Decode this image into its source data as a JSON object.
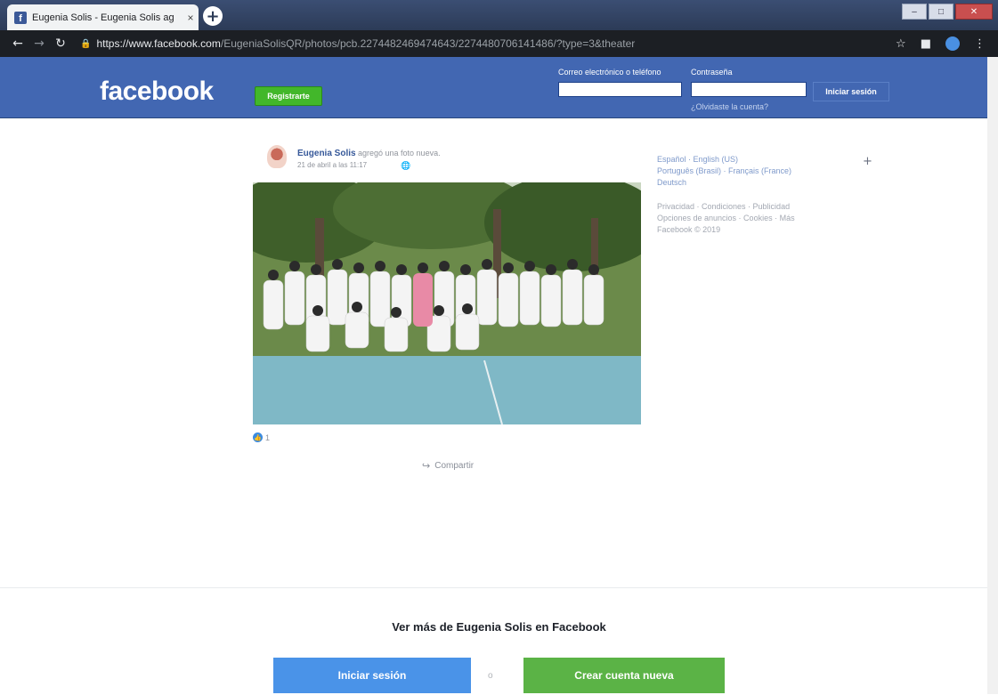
{
  "browser": {
    "tab_title": "Eugenia Solis - Eugenia Solis ag",
    "tab_close": "×",
    "new_tab": "+",
    "url_host": "https://www.facebook.com",
    "url_path": "/EugeniaSolisQR/photos/pcb.2274482469474643/2274480706141486/?type=3&theater",
    "icons": [
      "back-icon",
      "forward-icon",
      "reload-icon",
      "lock-icon",
      "star-icon",
      "extension-icon",
      "profile-icon",
      "menu-icon"
    ],
    "window_controls": [
      "minimize",
      "maximize",
      "close"
    ]
  },
  "header": {
    "logo": "facebook",
    "register_label": "Registrarte",
    "email_label": "Correo electrónico o teléfono",
    "password_label": "Contraseña",
    "login_label": "Iniciar sesión",
    "forgot_label": "¿Olvidaste la cuenta?",
    "colors": {
      "header_bg": "#4267b2",
      "register_bg": "#42b72a"
    }
  },
  "post": {
    "author": "Eugenia Solis",
    "action": "agregó una foto nueva.",
    "date": "21 de abril a las 11:17",
    "reaction_count": "1",
    "share_label": "Compartir"
  },
  "sidebar": {
    "lang_line_1": "Español · English (US)",
    "lang_line_2": "Português (Brasil) · Français (France)",
    "lang_line_3": "Deutsch",
    "footer_line_1": "Privacidad · Condiciones · Publicidad",
    "footer_line_2": "Opciones de anuncios · Cookies · Más",
    "footer_line_3": "Facebook © 2019"
  },
  "bottom": {
    "see_more": "Ver más de Eugenia Solis en Facebook",
    "login_label": "Iniciar sesión",
    "or_label": "o",
    "create_label": "Crear cuenta nueva",
    "colors": {
      "login_bg": "#4a93e8",
      "create_bg": "#5bb346"
    }
  }
}
